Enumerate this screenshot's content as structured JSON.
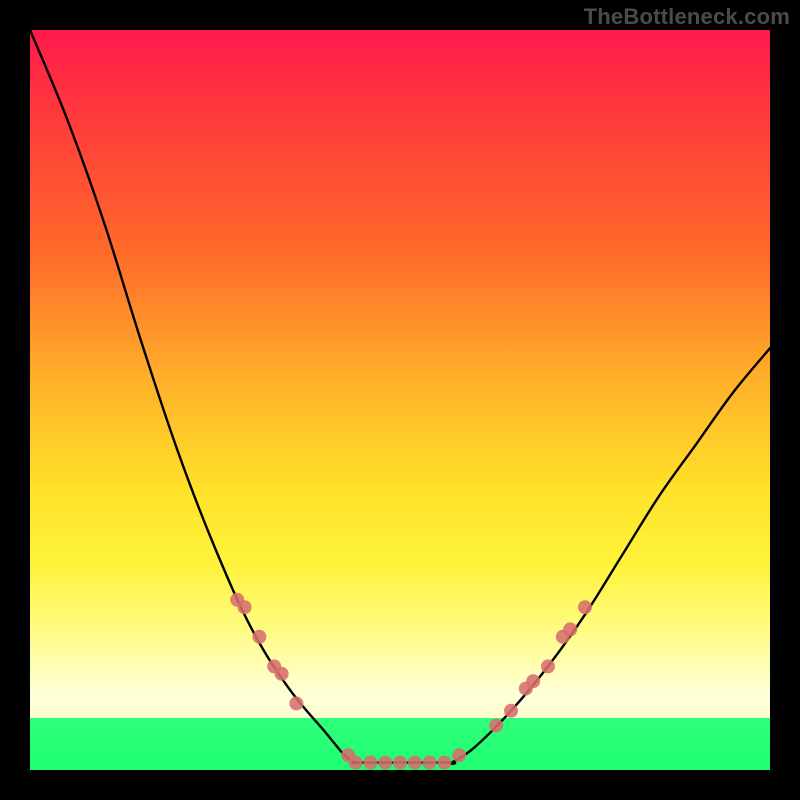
{
  "watermark": "TheBottleneck.com",
  "chart_data": {
    "type": "line",
    "title": "",
    "xlabel": "",
    "ylabel": "",
    "xlim": [
      0,
      100
    ],
    "ylim": [
      0,
      100
    ],
    "gradient_bands": [
      {
        "name": "red",
        "y_pct": 0
      },
      {
        "name": "orange",
        "y_pct": 40
      },
      {
        "name": "yellow",
        "y_pct": 70
      },
      {
        "name": "pale",
        "y_pct": 90
      },
      {
        "name": "green",
        "y_pct": 100
      }
    ],
    "series": [
      {
        "name": "left-curve",
        "x": [
          0,
          5,
          10,
          15,
          20,
          25,
          30,
          35,
          40,
          42.5,
          44
        ],
        "y": [
          100,
          88,
          74,
          58,
          43,
          30,
          19,
          11,
          5,
          2,
          1
        ]
      },
      {
        "name": "flat-bottom",
        "x": [
          44,
          50,
          57
        ],
        "y": [
          1,
          1,
          1
        ]
      },
      {
        "name": "right-curve",
        "x": [
          57,
          60,
          65,
          70,
          75,
          80,
          85,
          90,
          95,
          100
        ],
        "y": [
          1,
          3,
          8,
          14,
          21,
          29,
          37,
          44,
          51,
          57
        ]
      }
    ],
    "highlight_points": {
      "color": "#d86d6d",
      "radius_px": 7,
      "points": [
        {
          "x": 28,
          "y": 23
        },
        {
          "x": 29,
          "y": 22
        },
        {
          "x": 31,
          "y": 18
        },
        {
          "x": 33,
          "y": 14
        },
        {
          "x": 34,
          "y": 13
        },
        {
          "x": 36,
          "y": 9
        },
        {
          "x": 43,
          "y": 2
        },
        {
          "x": 44,
          "y": 1
        },
        {
          "x": 46,
          "y": 1
        },
        {
          "x": 48,
          "y": 1
        },
        {
          "x": 50,
          "y": 1
        },
        {
          "x": 52,
          "y": 1
        },
        {
          "x": 54,
          "y": 1
        },
        {
          "x": 56,
          "y": 1
        },
        {
          "x": 58,
          "y": 2
        },
        {
          "x": 63,
          "y": 6
        },
        {
          "x": 65,
          "y": 8
        },
        {
          "x": 67,
          "y": 11
        },
        {
          "x": 68,
          "y": 12
        },
        {
          "x": 70,
          "y": 14
        },
        {
          "x": 72,
          "y": 18
        },
        {
          "x": 73,
          "y": 19
        },
        {
          "x": 75,
          "y": 22
        }
      ]
    }
  }
}
